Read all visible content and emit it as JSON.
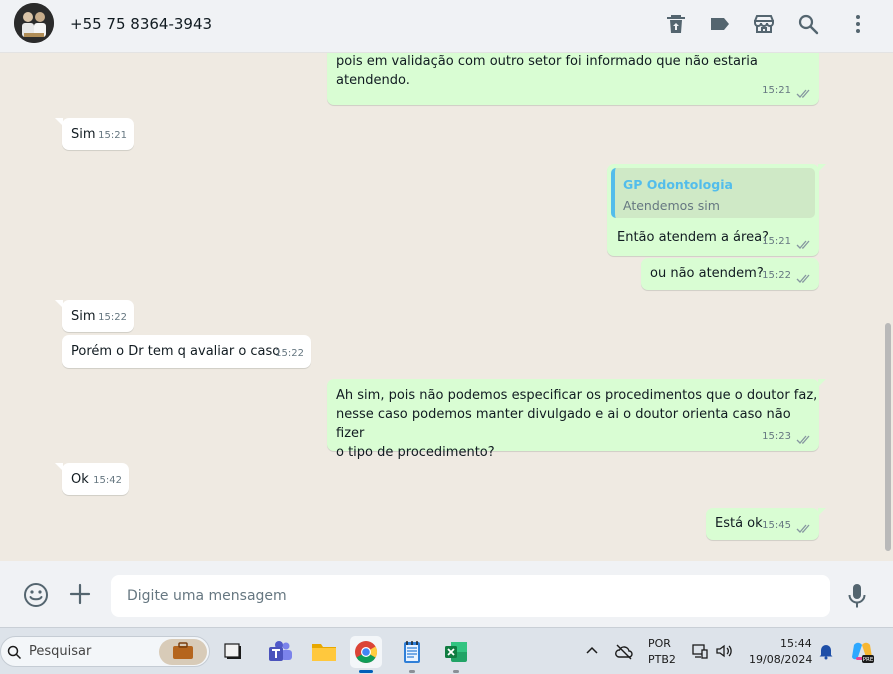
{
  "header": {
    "contact": "+55 75 8364-3943",
    "icons": [
      "delete-icon",
      "label-icon",
      "store-icon",
      "search-icon",
      "menu-icon"
    ]
  },
  "messages": [
    {
      "dir": "out",
      "lines": [
        "pois em validação com outro setor foi informado que não estaria",
        "atendendo."
      ],
      "time": "15:21"
    },
    {
      "dir": "in",
      "text": "Sim",
      "time": "15:21"
    },
    {
      "dir": "out",
      "quote": {
        "author": "GP Odontologia",
        "text": "Atendemos sim"
      },
      "text": "Então atendem a área?",
      "time": "15:21"
    },
    {
      "dir": "out",
      "text": "ou não atendem?",
      "time": "15:22"
    },
    {
      "dir": "in",
      "text": "Sim",
      "time": "15:22"
    },
    {
      "dir": "in",
      "text": "Porém o Dr tem q avaliar o caso",
      "time": "15:22"
    },
    {
      "dir": "out",
      "lines": [
        "Ah sim, pois não podemos especificar os procedimentos que o doutor faz,",
        "nesse caso podemos manter divulgado e ai o doutor orienta caso não fizer",
        "o tipo de procedimento?"
      ],
      "time": "15:23"
    },
    {
      "dir": "in",
      "text": "Ok",
      "time": "15:42"
    },
    {
      "dir": "out",
      "text": "Está ok",
      "time": "15:45"
    }
  ],
  "composer": {
    "placeholder": "Digite uma mensagem"
  },
  "taskbar": {
    "search_label": "Pesquisar",
    "lang_top": "POR",
    "lang_bottom": "PTB2",
    "time": "15:44",
    "date": "19/08/2024"
  },
  "colors": {
    "outgoing": "#d9fdd3",
    "incoming": "#ffffff",
    "chat_bg": "#efeae2",
    "quote_accent": "#53bdeb"
  }
}
